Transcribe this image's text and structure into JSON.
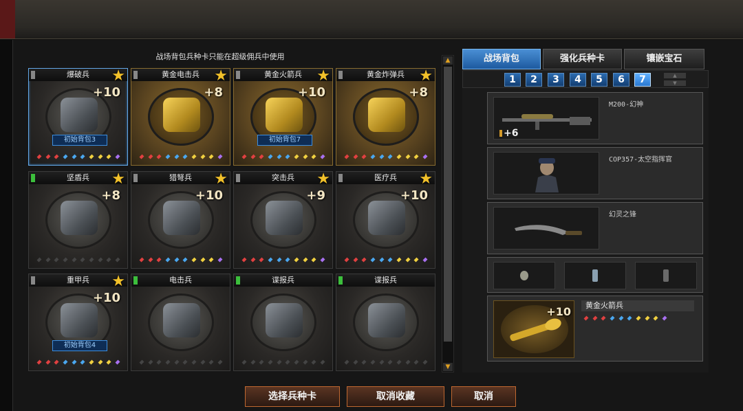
{
  "notice": "战场背包兵种卡只能在超级佣兵中使用",
  "cards": [
    {
      "name": "爆破兵",
      "level": "+10",
      "badge": "初始背包3",
      "tag": "gray",
      "star": true,
      "gold": false,
      "selected": true,
      "gems": "rrrbbbyyyp"
    },
    {
      "name": "黄金电击兵",
      "level": "+8",
      "badge": "",
      "tag": "gray",
      "star": true,
      "gold": true,
      "selected": false,
      "gems": "rrrbbbyyyp"
    },
    {
      "name": "黄金火箭兵",
      "level": "+10",
      "badge": "初始背包7",
      "tag": "gray",
      "star": true,
      "gold": true,
      "selected": false,
      "gems": "rrrbbbyyyp"
    },
    {
      "name": "黄金炸弹兵",
      "level": "+8",
      "badge": "",
      "tag": "gray",
      "star": true,
      "gold": true,
      "selected": false,
      "gems": "rrrbbbyyyp"
    },
    {
      "name": "坚盾兵",
      "level": "+8",
      "badge": "",
      "tag": "green",
      "star": true,
      "gold": false,
      "selected": false,
      "gems": "dddddddddd"
    },
    {
      "name": "猎弩兵",
      "level": "+10",
      "badge": "",
      "tag": "gray",
      "star": true,
      "gold": false,
      "selected": false,
      "gems": "rrrbbbyyyp"
    },
    {
      "name": "突击兵",
      "level": "+9",
      "badge": "",
      "tag": "gray",
      "star": true,
      "gold": false,
      "selected": false,
      "gems": "rrrbbbyyyp"
    },
    {
      "name": "医疗兵",
      "level": "+10",
      "badge": "",
      "tag": "gray",
      "star": true,
      "gold": false,
      "selected": false,
      "gems": "rrrbbbyyyp"
    },
    {
      "name": "重甲兵",
      "level": "+10",
      "badge": "初始背包4",
      "tag": "gray",
      "star": true,
      "gold": false,
      "selected": false,
      "gems": "rrrbbbyyyp"
    },
    {
      "name": "电击兵",
      "level": "",
      "badge": "",
      "tag": "green",
      "star": false,
      "gold": false,
      "selected": false,
      "gems": "dddddddddd"
    },
    {
      "name": "谍报兵",
      "level": "",
      "badge": "",
      "tag": "green",
      "star": false,
      "gold": false,
      "selected": false,
      "gems": "dddddddddd"
    },
    {
      "name": "谍报兵",
      "level": "",
      "badge": "",
      "tag": "green",
      "star": false,
      "gold": false,
      "selected": false,
      "gems": "dddddddddd"
    }
  ],
  "tabs": [
    {
      "label": "战场背包",
      "active": true
    },
    {
      "label": "强化兵种卡",
      "active": false
    },
    {
      "label": "镶嵌宝石",
      "active": false
    }
  ],
  "pages": [
    "1",
    "2",
    "3",
    "4",
    "5",
    "6",
    "7"
  ],
  "active_page": "7",
  "loadout": {
    "primary_name": "M200-幻神",
    "primary_ammo": "+6",
    "character_name": "COP357-太空指挥官",
    "melee_name": "幻灵之锋",
    "card_name": "黄金火箭兵",
    "card_level": "+10"
  },
  "buttons": {
    "select": "选择兵种卡",
    "unfavorite": "取消收藏",
    "cancel": "取消"
  },
  "colors": {
    "accent_blue": "#2a78d0",
    "gold_star": "#f2c12a",
    "button_border": "#c06830"
  }
}
